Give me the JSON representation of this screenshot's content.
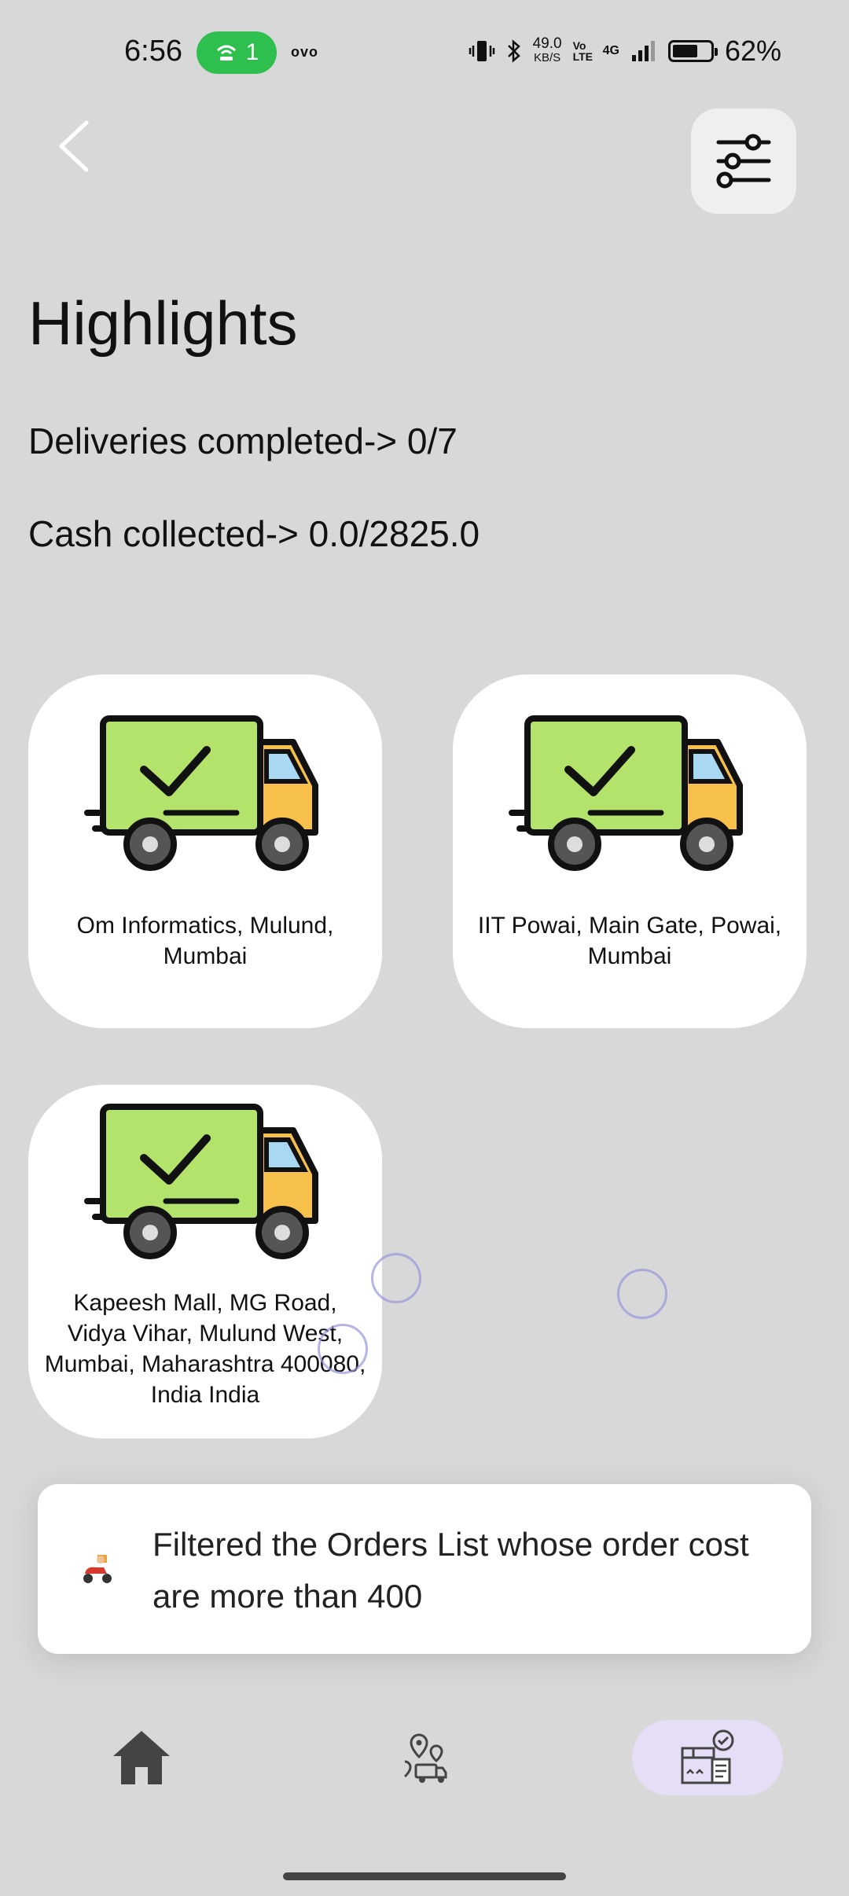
{
  "status_bar": {
    "time": "6:56",
    "hotspot_count": "1",
    "carrier": "ovo",
    "speed_value": "49.0",
    "speed_unit": "KB/S",
    "volte": "Vo LTE",
    "network": "4G",
    "battery": "62%"
  },
  "header": {
    "back_icon": "chevron-left-icon",
    "filter_icon": "sliders-icon"
  },
  "highlights": {
    "title": "Highlights",
    "deliveries": "Deliveries completed-> 0/7",
    "cash": "Cash collected-> 0.0/2825.0"
  },
  "cards": [
    {
      "label": "Om Informatics, Mulund, Mumbai",
      "icon": "delivery-truck-check-icon"
    },
    {
      "label": "IIT Powai, Main Gate, Powai, Mumbai",
      "icon": "delivery-truck-check-icon"
    },
    {
      "label": "Kapeesh Mall, MG Road, Vidya Vihar, Mulund West, Mumbai, Maharashtra 400080, India  India",
      "icon": "delivery-truck-check-icon"
    }
  ],
  "toast": {
    "icon": "scooter-delivery-icon",
    "message": "Filtered the Orders List whose order cost are more than 400"
  },
  "bottom_nav": {
    "items": [
      {
        "icon": "home-icon",
        "active": false
      },
      {
        "icon": "route-map-icon",
        "active": false
      },
      {
        "icon": "delivered-orders-icon",
        "active": true
      }
    ],
    "active_color": "#e6def6"
  },
  "colors": {
    "background": "#d8d8d8",
    "card": "#ffffff",
    "truck_body": "#b4e36b",
    "truck_cab": "#f7c04a",
    "hotspot": "#2fbf4f"
  }
}
